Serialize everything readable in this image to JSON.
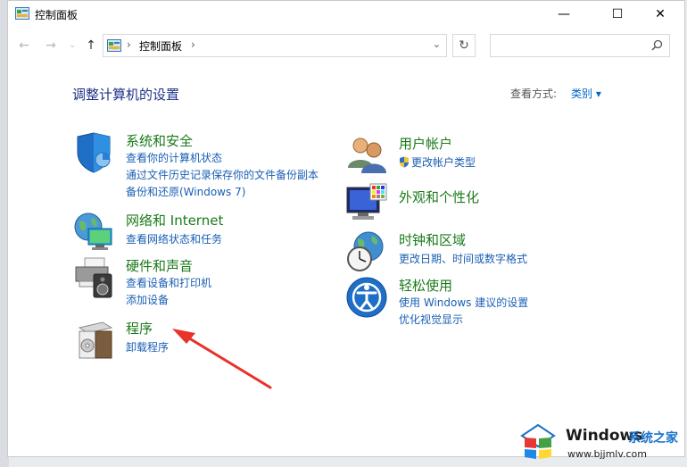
{
  "window": {
    "title": "控制面板",
    "minimize": "—",
    "maximize": "☐",
    "close": "✕"
  },
  "address": {
    "crumb": "控制面板",
    "sep": "›",
    "search_placeholder": ""
  },
  "main": {
    "heading": "调整计算机的设置",
    "view_by_label": "查看方式:",
    "view_by_value": "类别 ▾"
  },
  "categories": {
    "system": {
      "title": "系统和安全",
      "links": [
        "查看你的计算机状态",
        "通过文件历史记录保存你的文件备份副本",
        "备份和还原(Windows 7)"
      ]
    },
    "network": {
      "title": "网络和 Internet",
      "links": [
        "查看网络状态和任务"
      ]
    },
    "hardware": {
      "title": "硬件和声音",
      "links": [
        "查看设备和打印机",
        "添加设备"
      ]
    },
    "programs": {
      "title": "程序",
      "links": [
        "卸载程序"
      ]
    },
    "user": {
      "title": "用户帐户",
      "links": [
        "更改帐户类型"
      ]
    },
    "appearance": {
      "title": "外观和个性化",
      "links": []
    },
    "clock": {
      "title": "时钟和区域",
      "links": [
        "更改日期、时间或数字格式"
      ]
    },
    "ease": {
      "title": "轻松使用",
      "links": [
        "使用 Windows 建议的设置",
        "优化视觉显示"
      ]
    }
  },
  "watermark": {
    "brand": "Windows",
    "brand_cn": "系统之家",
    "url": "www.bjjmlv.com"
  },
  "colors": {
    "link": "#1a5fb4",
    "category_title": "#1a7a1a",
    "heading": "#1e3287",
    "arrow": "#e8322a"
  }
}
